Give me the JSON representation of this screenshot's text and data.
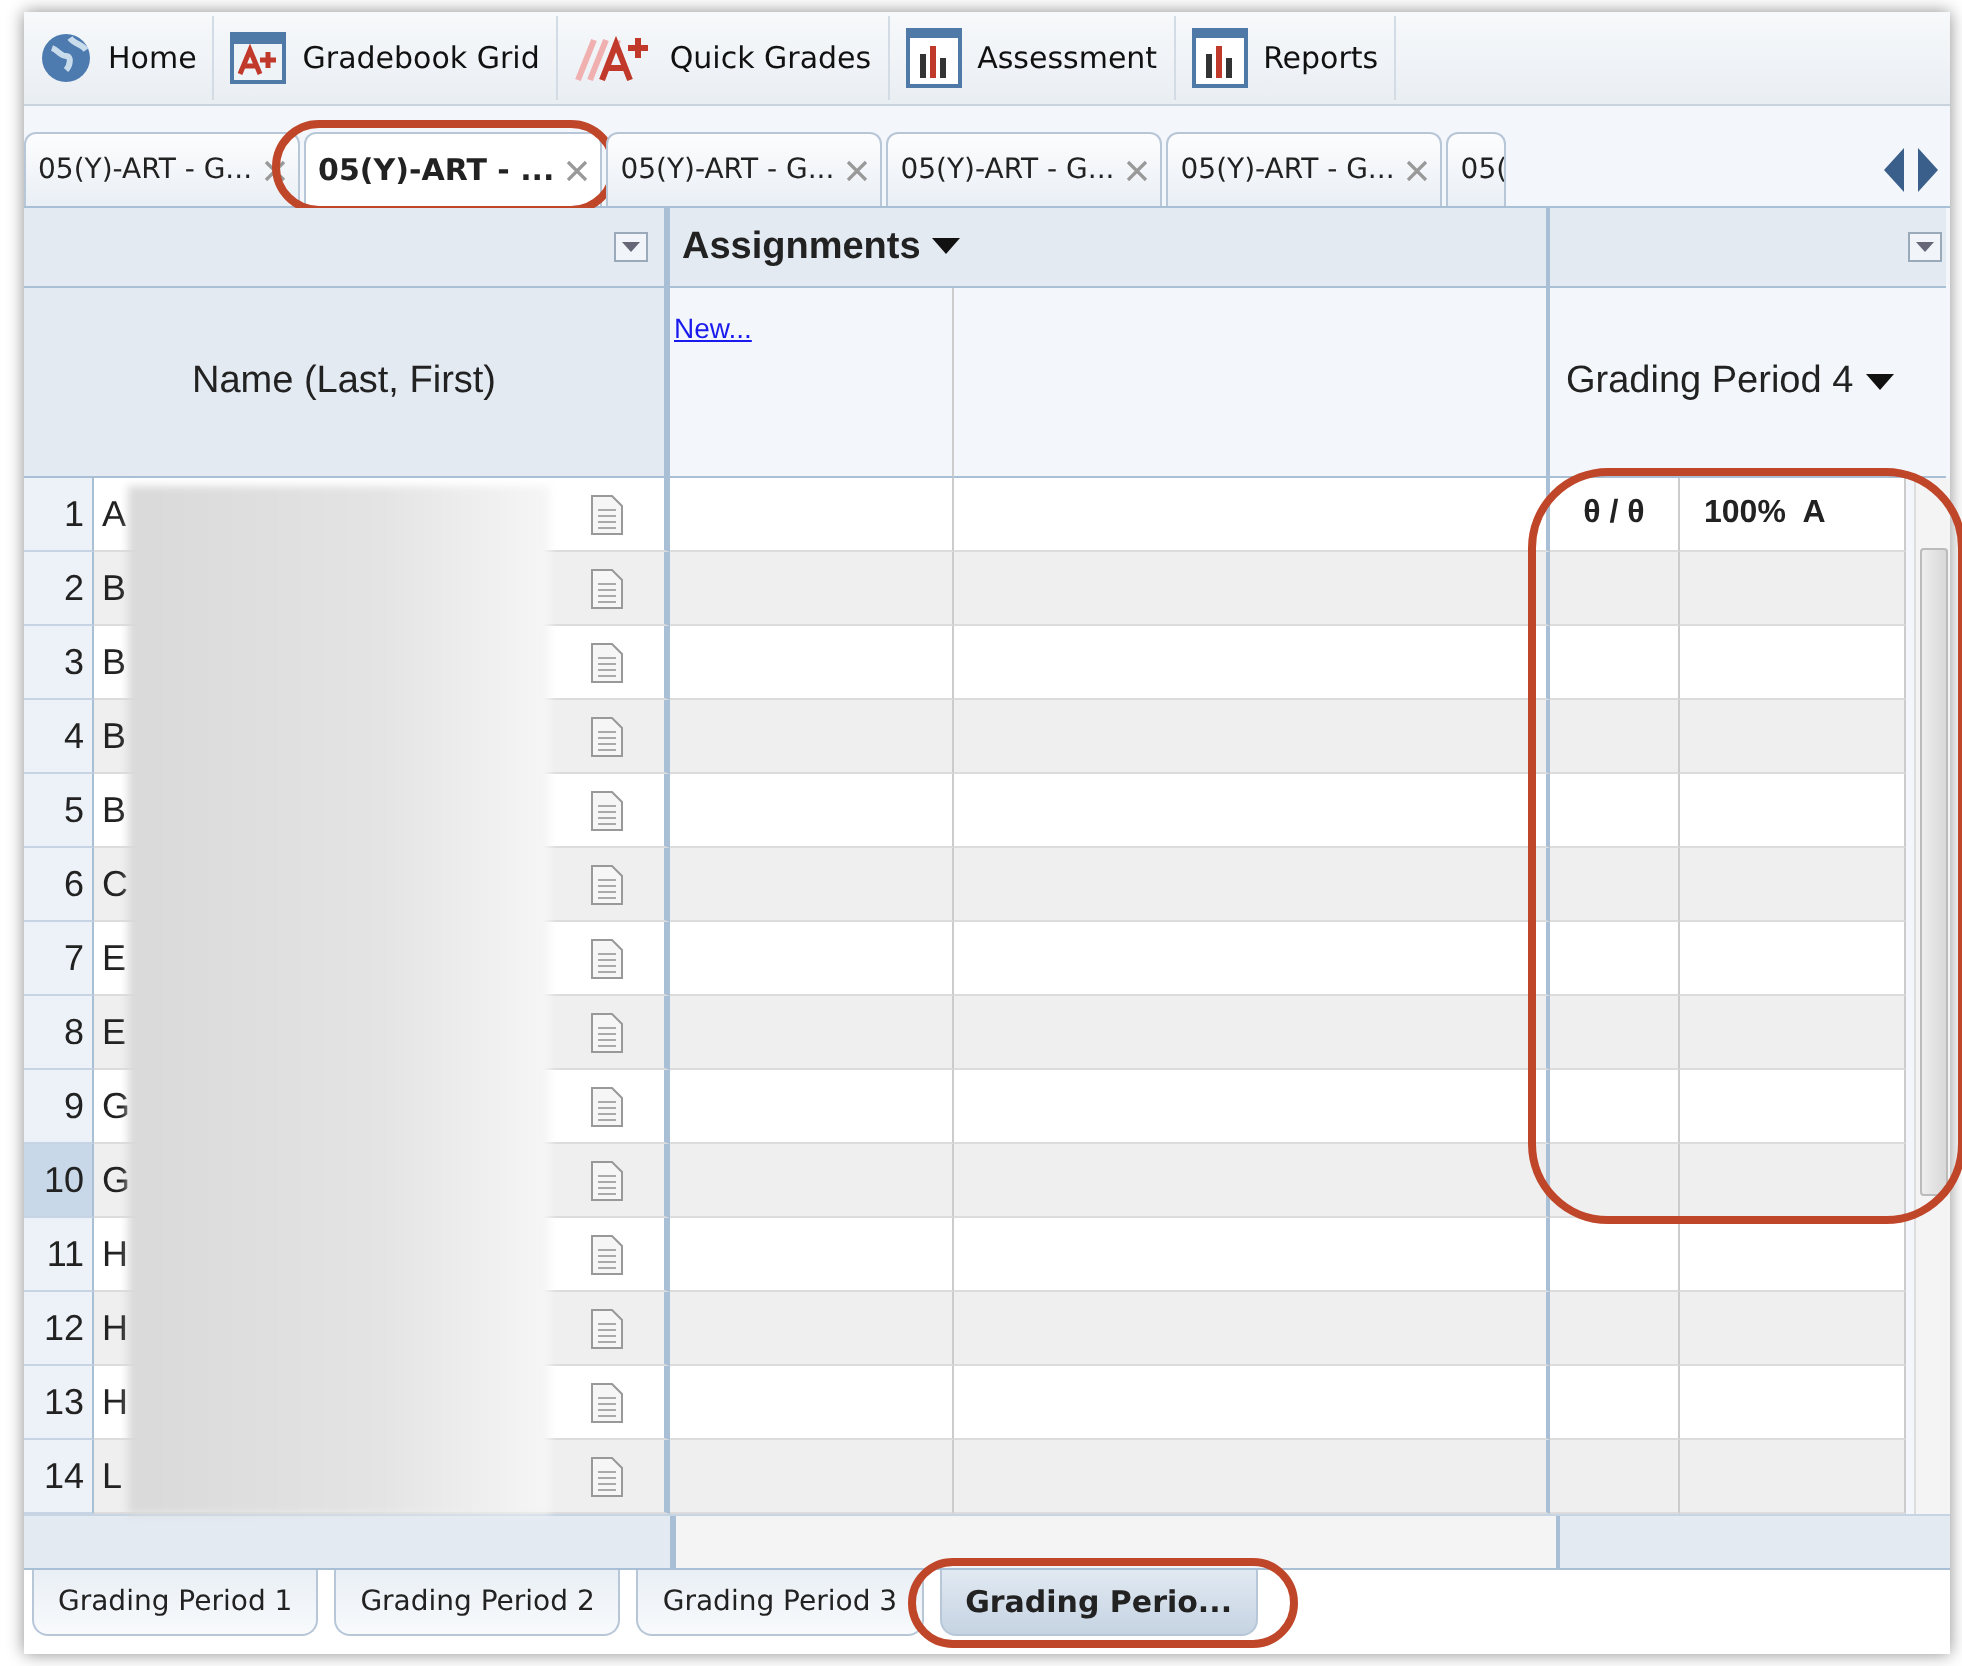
{
  "toolbar": [
    {
      "label": "Home"
    },
    {
      "label": "Gradebook Grid"
    },
    {
      "label": "Quick Grades"
    },
    {
      "label": "Assessment"
    },
    {
      "label": "Reports"
    }
  ],
  "class_tabs": [
    {
      "label": "05(Y)-ART - G...",
      "selected": false,
      "highlighted": false
    },
    {
      "label": "05(Y)-ART - ...",
      "selected": true,
      "highlighted": true
    },
    {
      "label": "05(Y)-ART - G...",
      "selected": false,
      "highlighted": false
    },
    {
      "label": "05(Y)-ART - G...",
      "selected": false,
      "highlighted": false
    },
    {
      "label": "05(Y)-ART - G...",
      "selected": false,
      "highlighted": false
    },
    {
      "label": "05(",
      "selected": false,
      "highlighted": false
    }
  ],
  "grid": {
    "assignments_header": "Assignments",
    "new_link": "New...",
    "name_header": "Name (Last, First)",
    "period_header": "Grading Period 4",
    "period_highlighted": true,
    "rows": [
      {
        "number": "1",
        "name": "A",
        "selected": false,
        "score": "θ / θ",
        "grade": "100%  A"
      },
      {
        "number": "2",
        "name": "B",
        "selected": false
      },
      {
        "number": "3",
        "name": "B",
        "selected": false
      },
      {
        "number": "4",
        "name": "B",
        "selected": false
      },
      {
        "number": "5",
        "name": "B",
        "selected": false
      },
      {
        "number": "6",
        "name": "C",
        "selected": false
      },
      {
        "number": "7",
        "name": "E",
        "selected": false
      },
      {
        "number": "8",
        "name": "E",
        "selected": false
      },
      {
        "number": "9",
        "name": "G",
        "selected": false
      },
      {
        "number": "10",
        "name": "G",
        "selected": true
      },
      {
        "number": "11",
        "name": "H",
        "selected": false
      },
      {
        "number": "12",
        "name": "H",
        "selected": false
      },
      {
        "number": "13",
        "name": "H",
        "selected": false
      },
      {
        "number": "14",
        "name": "L",
        "selected": false
      }
    ]
  },
  "period_tabs": [
    {
      "label": "Grading Period 1",
      "selected": false,
      "highlighted": false
    },
    {
      "label": "Grading Period 2",
      "selected": false,
      "highlighted": false
    },
    {
      "label": "Grading Period 3",
      "selected": false,
      "highlighted": false
    },
    {
      "label": "Grading Perio...",
      "selected": true,
      "highlighted": true
    }
  ]
}
